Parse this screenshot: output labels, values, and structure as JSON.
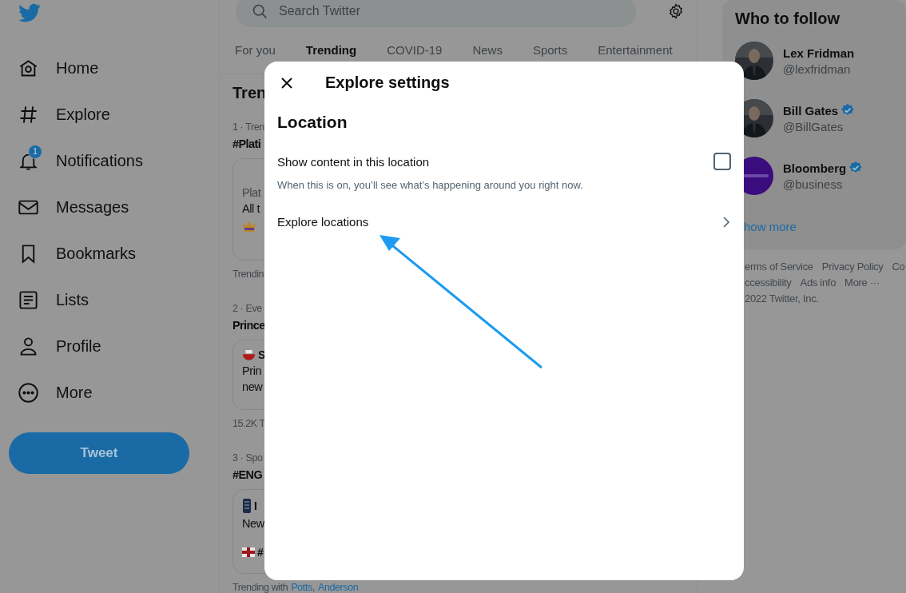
{
  "nav": {
    "items": [
      {
        "kind": "home",
        "label": "Home"
      },
      {
        "kind": "explore",
        "label": "Explore"
      },
      {
        "kind": "notifications",
        "label": "Notifications",
        "badge": "1"
      },
      {
        "kind": "messages",
        "label": "Messages"
      },
      {
        "kind": "bookmarks",
        "label": "Bookmarks"
      },
      {
        "kind": "lists",
        "label": "Lists"
      },
      {
        "kind": "profile",
        "label": "Profile"
      },
      {
        "kind": "more",
        "label": "More"
      }
    ],
    "tweet_button": "Tweet"
  },
  "search": {
    "placeholder": "Search Twitter"
  },
  "tabs": [
    {
      "label": "For you",
      "selected": false
    },
    {
      "label": "Trending",
      "selected": true
    },
    {
      "label": "COVID-19",
      "selected": false
    },
    {
      "label": "News",
      "selected": false
    },
    {
      "label": "Sports",
      "selected": false
    },
    {
      "label": "Entertainment",
      "selected": false
    }
  ],
  "trends": {
    "heading": "Tren",
    "items": [
      {
        "rank": "1 · Tren",
        "title": "#Plati",
        "card": {
          "lines": [
            "Plat",
            "All t"
          ]
        },
        "footer": "Trendin"
      },
      {
        "rank": "2 · Eve",
        "title": "Prince",
        "card": {
          "source": "S",
          "lines": [
            "Prin",
            "new"
          ]
        },
        "footer": "15.2K T"
      },
      {
        "rank": "3 · Spo",
        "title": "#ENG",
        "card": {
          "source": "I",
          "lines": [
            "New"
          ],
          "tag": "#"
        },
        "footer_prefix": "Trending with",
        "footer_links": [
          "Potts",
          "Anderson"
        ],
        "footer_separator": ","
      }
    ]
  },
  "modal": {
    "title": "Explore settings",
    "section": "Location",
    "setting": {
      "label": "Show content in this location",
      "description": "When this is on, you’ll see what’s happening around you right now.",
      "checked": false
    },
    "link": "Explore locations"
  },
  "who_to_follow": {
    "title": "Who to follow",
    "accounts": [
      {
        "name": "Lex Fridman",
        "handle": "@lexfridman",
        "verified": false
      },
      {
        "name": "Bill Gates",
        "handle": "@BillGates",
        "verified": true
      },
      {
        "name": "Bloomberg",
        "handle": "@business",
        "verified": true
      }
    ],
    "show_more": "how more"
  },
  "footer": [
    [
      "erms of Service",
      "Privacy Policy",
      "Co"
    ],
    [
      "ccessibility",
      "Ads info",
      "More ···"
    ],
    [
      "2022 Twitter, Inc."
    ]
  ]
}
